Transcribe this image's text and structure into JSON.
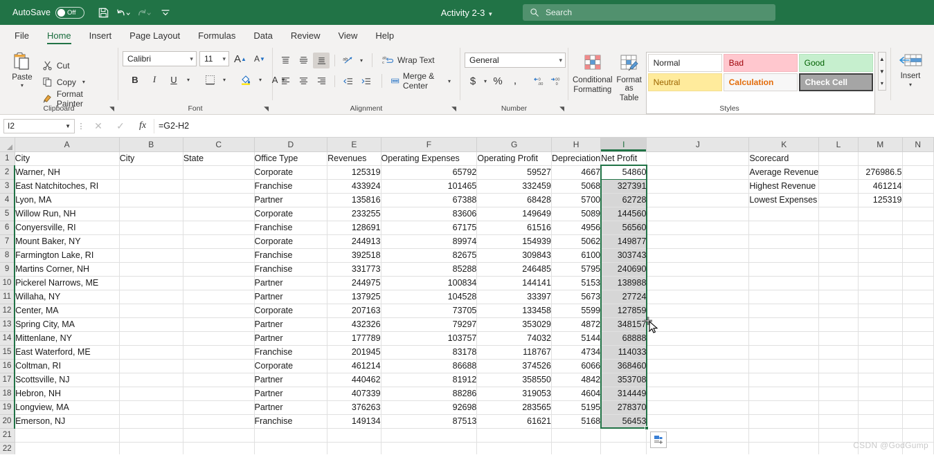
{
  "titlebar": {
    "autosave_label": "AutoSave",
    "autosave_state": "Off",
    "doc_title": "Activity 2-3",
    "qat": [
      {
        "name": "save-icon",
        "label": "Save"
      },
      {
        "name": "undo-icon",
        "label": "Undo"
      },
      {
        "name": "redo-icon",
        "label": "Redo"
      },
      {
        "name": "customize-quick-access-toolbar-icon",
        "label": "Customize Quick Access Toolbar"
      }
    ],
    "search_placeholder": "Search",
    "search_value": ""
  },
  "tabs": [
    {
      "label": "File",
      "active": false
    },
    {
      "label": "Home",
      "active": true
    },
    {
      "label": "Insert",
      "active": false
    },
    {
      "label": "Page Layout",
      "active": false
    },
    {
      "label": "Formulas",
      "active": false
    },
    {
      "label": "Data",
      "active": false
    },
    {
      "label": "Review",
      "active": false
    },
    {
      "label": "View",
      "active": false
    },
    {
      "label": "Help",
      "active": false
    }
  ],
  "ribbon": {
    "clipboard": {
      "group_label": "Clipboard",
      "paste_label": "Paste",
      "items": [
        {
          "label": "Cut",
          "icon": "scissors-icon"
        },
        {
          "label": "Copy",
          "icon": "copy-icon"
        },
        {
          "label": "Format Painter",
          "icon": "format-painter-icon"
        }
      ]
    },
    "font": {
      "group_label": "Font",
      "font_name": "Calibri",
      "font_size": "11",
      "grow_label": "A",
      "shrink_label": "A",
      "bold_label": "B",
      "italic_label": "I",
      "underline_label": "U"
    },
    "alignment": {
      "group_label": "Alignment",
      "wrap_text_label": "Wrap Text",
      "merge_center_label": "Merge & Center"
    },
    "number": {
      "group_label": "Number",
      "format_value": "General",
      "currency_label": "$",
      "percent_label": "%",
      "comma_label": ","
    },
    "styles": {
      "group_label": "Styles",
      "conditional_formatting_label": "Conditional\nFormatting",
      "conditional_formatting_l1": "Conditional",
      "conditional_formatting_l2": "Formatting",
      "format_as_table_l1": "Format as",
      "format_as_table_l2": "Table",
      "gallery": [
        {
          "label": "Normal",
          "style": "s-normal"
        },
        {
          "label": "Bad",
          "style": "s-bad"
        },
        {
          "label": "Good",
          "style": "s-good"
        },
        {
          "label": "Neutral",
          "style": "s-neutral"
        },
        {
          "label": "Calculation",
          "style": "s-calc"
        },
        {
          "label": "Check Cell",
          "style": "s-check"
        }
      ]
    },
    "cells": {
      "insert_label": "Insert"
    }
  },
  "formulabar": {
    "name_box": "I2",
    "cancel_icon": "close-icon",
    "enter_icon": "check-icon",
    "function_icon": "fx-icon",
    "formula": "=G2-H2"
  },
  "grid": {
    "columns": [
      "A",
      "B",
      "C",
      "D",
      "E",
      "F",
      "G",
      "H",
      "I",
      "J",
      "K",
      "L",
      "M",
      "N"
    ],
    "selected_column": "I",
    "rows": [
      "1",
      "2",
      "3",
      "4",
      "5",
      "6",
      "7",
      "8",
      "9",
      "10",
      "11",
      "12",
      "13",
      "14",
      "15",
      "16",
      "17",
      "18",
      "19",
      "20",
      "21",
      "22"
    ],
    "headers": {
      "A": "City",
      "B": "City",
      "C": "State",
      "D": "Office Type",
      "E": "Revenues",
      "F": "Operating Expenses",
      "G": "Operating Profit",
      "H": "Depreciation",
      "I": "Net Profit",
      "K": "Scorecard"
    },
    "data": [
      {
        "r": "2",
        "A": "Warner, NH",
        "D": "Corporate",
        "E": "125319",
        "F": "65792",
        "G": "59527",
        "H": "4667",
        "I": "54860"
      },
      {
        "r": "3",
        "A": "East Natchitoches, RI",
        "D": "Franchise",
        "E": "433924",
        "F": "101465",
        "G": "332459",
        "H": "5068",
        "I": "327391"
      },
      {
        "r": "4",
        "A": "Lyon, MA",
        "D": "Partner",
        "E": "135816",
        "F": "67388",
        "G": "68428",
        "H": "5700",
        "I": "62728"
      },
      {
        "r": "5",
        "A": "Willow Run, NH",
        "D": "Corporate",
        "E": "233255",
        "F": "83606",
        "G": "149649",
        "H": "5089",
        "I": "144560"
      },
      {
        "r": "6",
        "A": "Conyersville, RI",
        "D": "Franchise",
        "E": "128691",
        "F": "67175",
        "G": "61516",
        "H": "4956",
        "I": "56560"
      },
      {
        "r": "7",
        "A": "Mount Baker, NY",
        "D": "Corporate",
        "E": "244913",
        "F": "89974",
        "G": "154939",
        "H": "5062",
        "I": "149877"
      },
      {
        "r": "8",
        "A": "Farmington Lake, RI",
        "D": "Franchise",
        "E": "392518",
        "F": "82675",
        "G": "309843",
        "H": "6100",
        "I": "303743"
      },
      {
        "r": "9",
        "A": "Martins Corner, NH",
        "D": "Franchise",
        "E": "331773",
        "F": "85288",
        "G": "246485",
        "H": "5795",
        "I": "240690"
      },
      {
        "r": "10",
        "A": "Pickerel Narrows, ME",
        "D": "Partner",
        "E": "244975",
        "F": "100834",
        "G": "144141",
        "H": "5153",
        "I": "138988"
      },
      {
        "r": "11",
        "A": "Willaha, NY",
        "D": "Partner",
        "E": "137925",
        "F": "104528",
        "G": "33397",
        "H": "5673",
        "I": "27724"
      },
      {
        "r": "12",
        "A": "Center, MA",
        "D": "Corporate",
        "E": "207163",
        "F": "73705",
        "G": "133458",
        "H": "5599",
        "I": "127859"
      },
      {
        "r": "13",
        "A": "Spring City, MA",
        "D": "Partner",
        "E": "432326",
        "F": "79297",
        "G": "353029",
        "H": "4872",
        "I": "348157"
      },
      {
        "r": "14",
        "A": "Mittenlane, NY",
        "D": "Partner",
        "E": "177789",
        "F": "103757",
        "G": "74032",
        "H": "5144",
        "I": "68888"
      },
      {
        "r": "15",
        "A": "East Waterford, ME",
        "D": "Franchise",
        "E": "201945",
        "F": "83178",
        "G": "118767",
        "H": "4734",
        "I": "114033"
      },
      {
        "r": "16",
        "A": "Coltman, RI",
        "D": "Corporate",
        "E": "461214",
        "F": "86688",
        "G": "374526",
        "H": "6066",
        "I": "368460"
      },
      {
        "r": "17",
        "A": "Scottsville, NJ",
        "D": "Partner",
        "E": "440462",
        "F": "81912",
        "G": "358550",
        "H": "4842",
        "I": "353708"
      },
      {
        "r": "18",
        "A": "Hebron, NH",
        "D": "Partner",
        "E": "407339",
        "F": "88286",
        "G": "319053",
        "H": "4604",
        "I": "314449"
      },
      {
        "r": "19",
        "A": "Longview, MA",
        "D": "Partner",
        "E": "376263",
        "F": "92698",
        "G": "283565",
        "H": "5195",
        "I": "278370"
      },
      {
        "r": "20",
        "A": "Emerson, NJ",
        "D": "Franchise",
        "E": "149134",
        "F": "87513",
        "G": "61621",
        "H": "5168",
        "I": "56453"
      },
      {
        "r": "21",
        "A": "",
        "D": "",
        "E": "",
        "F": "",
        "G": "",
        "H": "",
        "I": ""
      },
      {
        "r": "22",
        "A": "",
        "D": "",
        "E": "",
        "F": "",
        "G": "",
        "H": "",
        "I": ""
      }
    ],
    "scorecard": {
      "title": "Scorecard",
      "rows": [
        {
          "label": "Average Revenue",
          "value": "276986.5"
        },
        {
          "label": "Highest Revenue",
          "value": "461214"
        },
        {
          "label": "Lowest Expenses",
          "value": "125319"
        }
      ]
    },
    "watermark": "CSDN @GodGump"
  },
  "colors": {
    "brand_green": "#217346",
    "selection_border": "#217346",
    "selected_fill": "#d6d6d6",
    "header_gray": "#e6e6e6"
  }
}
